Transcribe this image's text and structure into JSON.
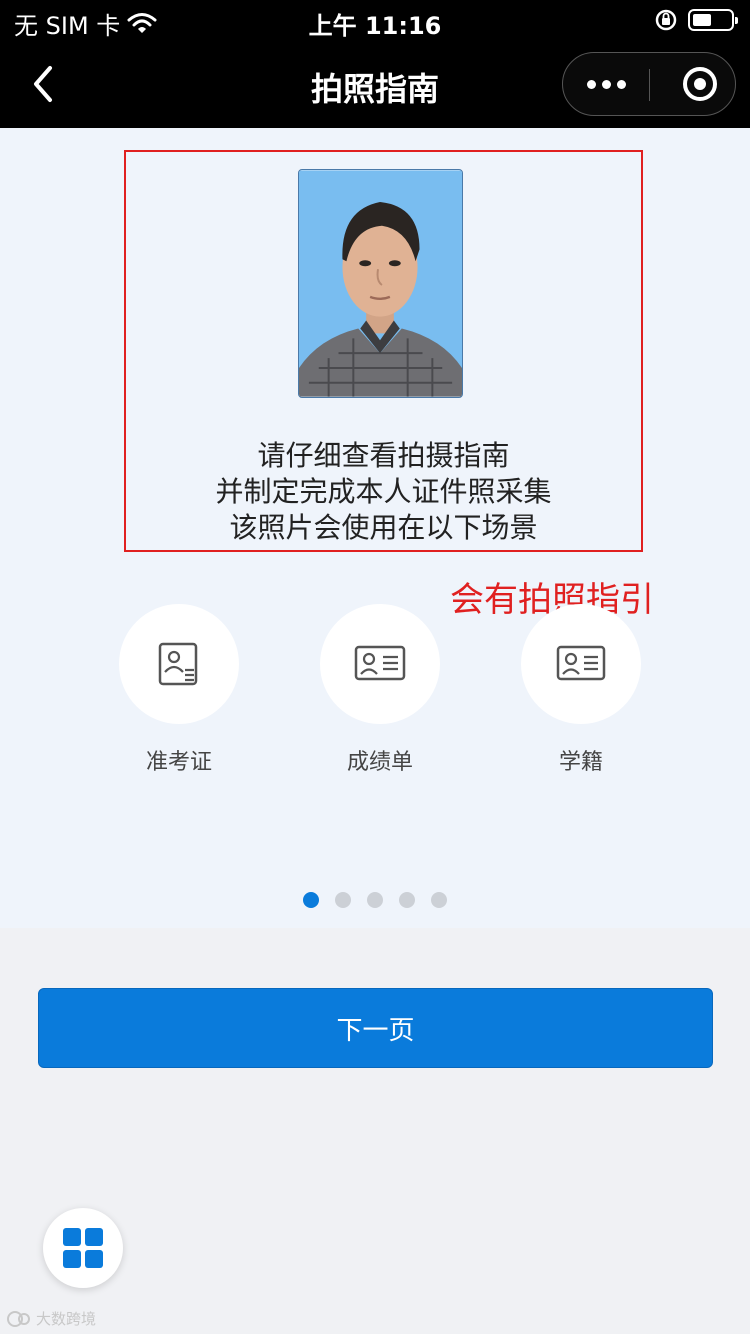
{
  "status_bar": {
    "carrier": "无 SIM 卡",
    "time": "上午 11:16",
    "battery_level": 0.5
  },
  "navbar": {
    "title": "拍照指南",
    "icons": [
      "chevron-left-icon",
      "more-dots-icon",
      "target-close-icon"
    ]
  },
  "guide": {
    "lines": [
      "请仔细查看拍摄指南",
      "并制定完成本人证件照采集",
      "该照片会使用在以下场景"
    ]
  },
  "annotation": "会有拍照指引",
  "scenes": [
    {
      "label": "准考证",
      "icon": "id-card-icon"
    },
    {
      "label": "成绩单",
      "icon": "transcript-icon"
    },
    {
      "label": "学籍",
      "icon": "student-status-icon"
    }
  ],
  "pagination": {
    "total": 5,
    "current": 1
  },
  "next_button": "下一页",
  "watermark": "大数跨境",
  "colors": {
    "accent": "#0a7bdb",
    "annotation": "#e02020",
    "photo_bg": "#79bdf0"
  }
}
